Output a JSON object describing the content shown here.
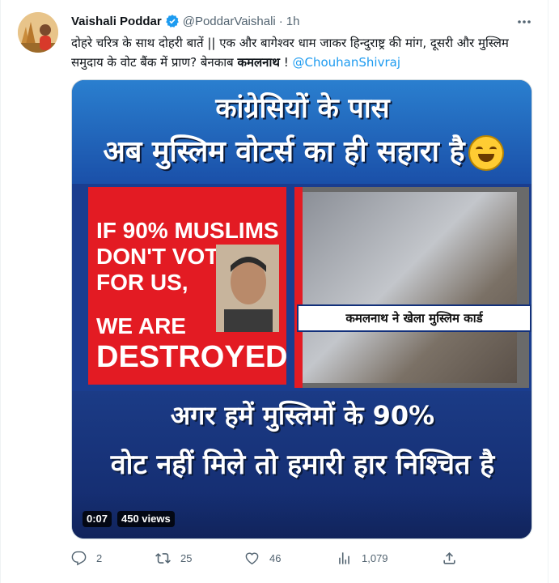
{
  "tweet": {
    "author_name": "Vaishali Poddar",
    "handle": "@PoddarVaishali",
    "separator": "·",
    "time": "1h",
    "text_part1": "दोहरे चरित्र के साथ दोहरी बातें || एक और बागेश्वर धाम जाकर हिन्दुराष्ट्र की मांग, दूसरी और मुस्लिम समुदाय के वोट बैंक में प्राण? बेनकाब ",
    "text_bold": "कमलनाथ",
    "text_part2": " ! ",
    "mention": "@ChouhanShivraj"
  },
  "media": {
    "headline_top_1": "कांग्रेसियों के पास",
    "headline_top_2": "अब मुस्लिम वोटर्स का ही सहारा है",
    "red_line_1": "IF 90% MUSLIMS",
    "red_line_2": "DON'T VOTE",
    "red_line_3": "FOR US,",
    "red_line_4": "WE ARE",
    "red_line_5": "DESTROYED",
    "caption": "कमलनाथ ने खेला मुस्लिम कार्ड",
    "headline_bottom_1": "अगर हमें मुस्लिमों के 90%",
    "headline_bottom_2": "वोट नहीं मिले तो हमारी हार निश्चित है",
    "duration": "0:07",
    "views": "450 views"
  },
  "actions": {
    "replies": "2",
    "retweets": "25",
    "likes": "46",
    "views": "1,079"
  },
  "colors": {
    "accent": "#1d9bf0",
    "muted": "#536471",
    "red": "#e31b23"
  }
}
